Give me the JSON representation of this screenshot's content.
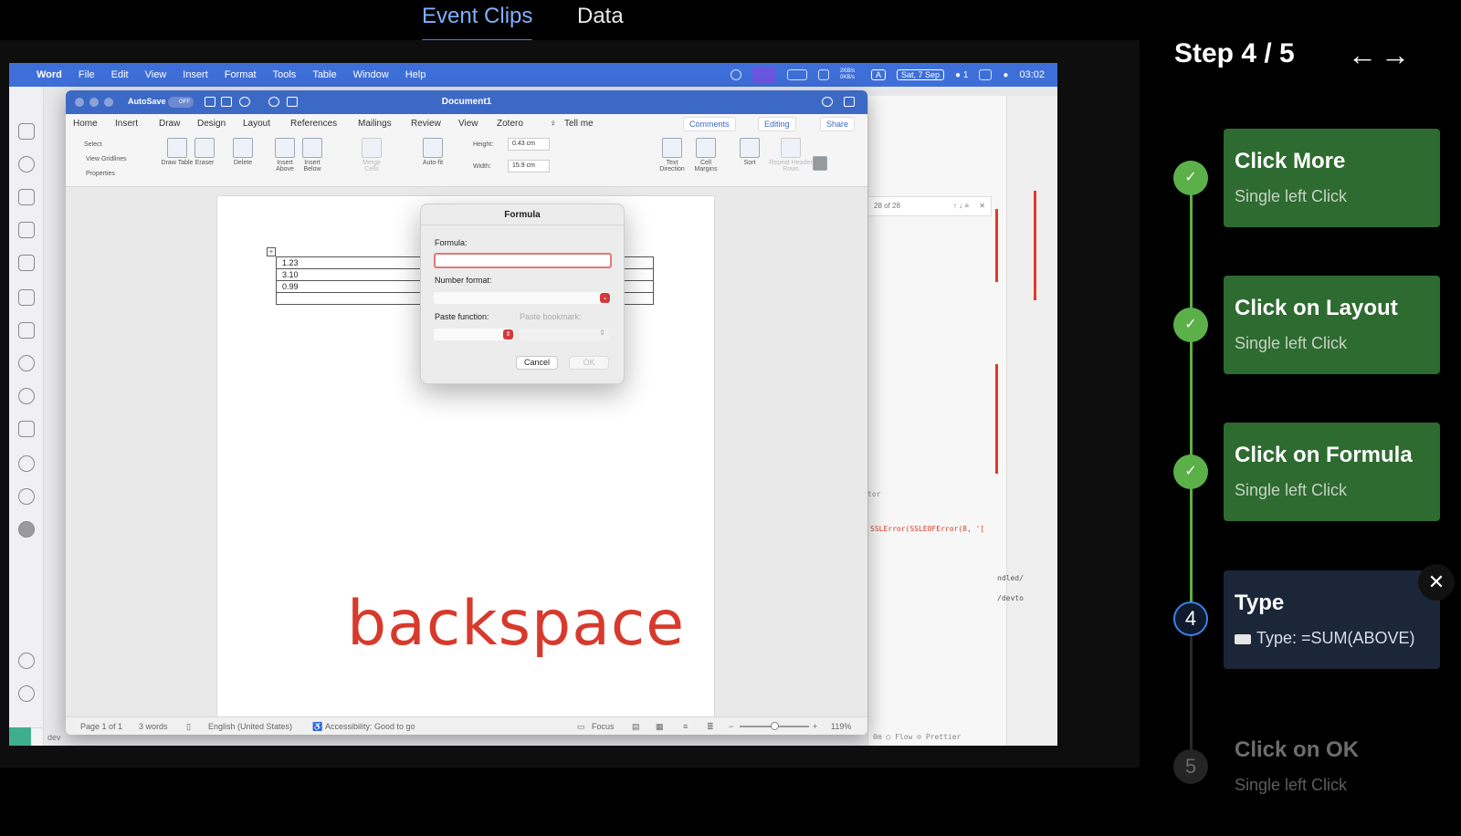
{
  "tabs": [
    {
      "label": "Event Clips"
    },
    {
      "label": "Data"
    }
  ],
  "menubar": {
    "items": [
      "Word",
      "File",
      "Edit",
      "View",
      "Insert",
      "Format",
      "Tools",
      "Table",
      "Window",
      "Help"
    ],
    "net_speed": "2KB/s 0KB/s",
    "input_indicator": "A",
    "date": "Sat, 7 Sep",
    "wechat_count": "1",
    "time": "03:02"
  },
  "word": {
    "autosave": "AutoSave",
    "autosave_state": "OFF",
    "doc_title": "Document1",
    "ribbon_tabs": [
      "Home",
      "Insert",
      "Draw",
      "Design",
      "Layout",
      "References",
      "Mailings",
      "Review",
      "View",
      "Zotero"
    ],
    "tell_me": "Tell me",
    "comments": "Comments",
    "editing": "Editing",
    "share": "Share",
    "ribbon": {
      "select": "Select",
      "view_gridlines": "View Gridlines",
      "properties": "Properties",
      "draw_table": "Draw Table",
      "eraser": "Eraser",
      "delete": "Delete",
      "insert_above": "Insert Above",
      "insert_below": "Insert Below",
      "merge_cells": "Merge Cells",
      "auto_fit": "Auto-fit",
      "height_label": "Height:",
      "height_value": "0.43 cm",
      "width_label": "Width:",
      "width_value": "15.9 cm",
      "text_direction": "Text Direction",
      "cell_margins": "Cell Margins",
      "sort": "Sort",
      "repeat_header_rows": "Repeat Header Rows"
    },
    "table_values": [
      "1.23",
      "3.10",
      "0.99",
      ""
    ],
    "status": {
      "page": "Page 1 of 1",
      "words": "3 words",
      "language": "English (United States)",
      "accessibility": "Accessibility: Good to go",
      "focus": "Focus",
      "zoom": "119%"
    }
  },
  "dialog": {
    "title": "Formula",
    "formula_label": "Formula:",
    "formula_value": "",
    "number_format_label": "Number format:",
    "paste_function_label": "Paste function:",
    "paste_bookmark_label": "Paste bookmark:",
    "cancel": "Cancel",
    "ok": "OK"
  },
  "background": {
    "find_count": "28 of 28",
    "error_text": "SSLError(SSLEOFError(8, '[",
    "code_1": "ndled/",
    "code_2": "/devto",
    "vs_status_left": "dev",
    "vs_status_flow": "Flow",
    "vs_status_prettier": "Prettier",
    "vs_status_time": "0m",
    "tor_label": "tor"
  },
  "keystroke_overlay": "backspace",
  "steps_panel": {
    "title": "Step 4 / 5",
    "prev_icon": "arrow-left",
    "next_icon": "arrow-right",
    "steps": [
      {
        "num": "1",
        "title": "Click More",
        "subtitle": "Single left Click",
        "state": "done"
      },
      {
        "num": "2",
        "title": "Click on Layout",
        "subtitle": "Single left Click",
        "state": "done"
      },
      {
        "num": "3",
        "title": "Click on Formula",
        "subtitle": "Single left Click",
        "state": "done"
      },
      {
        "num": "4",
        "title": "Type",
        "subtitle": "Type: =SUM(ABOVE)",
        "state": "current"
      },
      {
        "num": "5",
        "title": "Click on OK",
        "subtitle": "Single left Click",
        "state": "todo"
      }
    ],
    "colors": {
      "done": "#2e6b30",
      "current": "#1b2638",
      "accent": "#3f7fe8",
      "check": "#5cb04a"
    }
  }
}
